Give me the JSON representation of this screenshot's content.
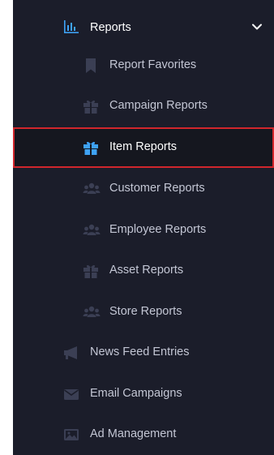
{
  "sidebar": {
    "reports": {
      "label": "Reports",
      "icon": "bar-chart-icon",
      "expanded": true
    },
    "children": [
      {
        "label": "Report Favorites",
        "icon": "bookmark-icon"
      },
      {
        "label": "Campaign Reports",
        "icon": "gift-icon"
      },
      {
        "label": "Item Reports",
        "icon": "gift-icon",
        "active": true
      },
      {
        "label": "Customer Reports",
        "icon": "users-icon"
      },
      {
        "label": "Employee Reports",
        "icon": "users-icon"
      },
      {
        "label": "Asset Reports",
        "icon": "gift-icon"
      },
      {
        "label": "Store Reports",
        "icon": "users-icon"
      }
    ],
    "items": [
      {
        "label": "News Feed Entries",
        "icon": "megaphone-icon"
      },
      {
        "label": "Email Campaigns",
        "icon": "envelope-icon"
      },
      {
        "label": "Ad Management",
        "icon": "image-icon"
      }
    ]
  },
  "colors": {
    "background": "#1b1d2a",
    "active_background": "#15171f",
    "active_border": "#d0262c",
    "accent_blue": "#3ea2f4",
    "muted_icon": "#3b3f54",
    "text": "#c3c6d4"
  }
}
